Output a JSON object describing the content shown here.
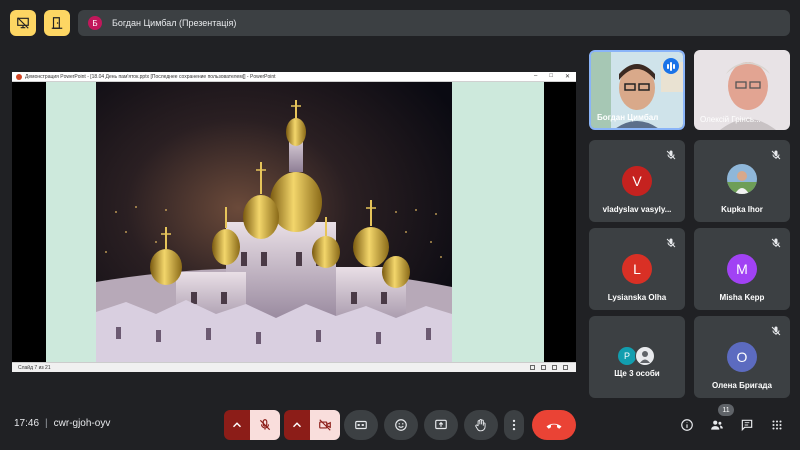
{
  "top": {
    "presenter_initial": "Б",
    "presenter_label": "Богдан Цимбал (Презентація)"
  },
  "presentation": {
    "window_title": "Демонстрация PowerPoint - [18.04 День пам'яток.pptx [Последнее сохранение пользователем]] - PowerPoint",
    "status_text": "Слайд 7 из 21"
  },
  "participants": [
    {
      "name": "Богдан Цимбал",
      "type": "video"
    },
    {
      "name": "Олексій Грінсь...",
      "type": "video"
    },
    {
      "name": "vladyslav vasyly...",
      "initial": "V",
      "color": "#c5221f"
    },
    {
      "name": "Kupka Ihor",
      "type": "photo"
    },
    {
      "name": "Lysianska Olha",
      "initial": "L",
      "color": "#d93025"
    },
    {
      "name": "Misha Kepp",
      "initial": "M",
      "color": "#a142f4"
    },
    {
      "name": "Ще 3 особи",
      "initial": "P",
      "color": "#129eaf"
    },
    {
      "name": "Олена Бригада",
      "initial": "О",
      "color": "#5c6bc0"
    }
  ],
  "bottom": {
    "time": "17:46",
    "separator": "|",
    "meeting_code": "cwr-gjoh-oyv",
    "participants_count": "11"
  },
  "colors": {
    "accent_yellow": "#fdd663",
    "end_call_red": "#ea4335",
    "muted_red": "#8c1d18",
    "muted_pink": "#f9dedc"
  }
}
